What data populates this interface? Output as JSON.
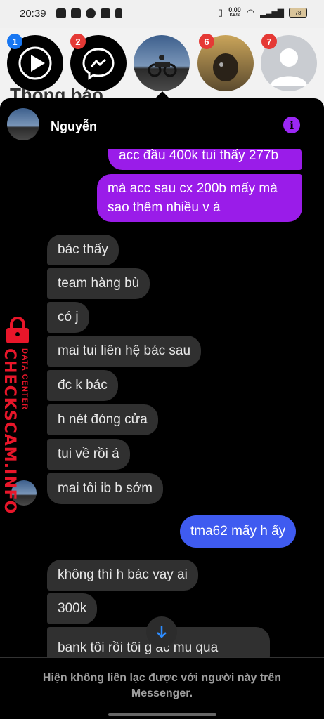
{
  "status_bar": {
    "time": "20:39",
    "net_speed": "0.00",
    "net_unit": "KB/S",
    "battery": "78"
  },
  "chat_heads": [
    {
      "badge": "1",
      "badge_color": "#1877f2"
    },
    {
      "badge": "2",
      "badge_color": "#e53935"
    },
    {
      "badge": "6",
      "badge_color": "#e53935"
    },
    {
      "badge": "7",
      "badge_color": "#e53935"
    }
  ],
  "background_title": "Thông báo",
  "chat": {
    "contact_name": "Nguyễn",
    "messages": [
      {
        "from": "me",
        "text": "acc đầu 400k tui thấy 277b"
      },
      {
        "from": "me",
        "text": "mà acc sau cx 200b mấy mà"
      },
      {
        "from": "me",
        "text": "sao thêm nhiều v á"
      },
      {
        "from": "them",
        "text": "bác thấy"
      },
      {
        "from": "them",
        "text": "team hàng bù"
      },
      {
        "from": "them",
        "text": "có j"
      },
      {
        "from": "them",
        "text": "mai tui liên hệ bác sau"
      },
      {
        "from": "them",
        "text": "đc k bác"
      },
      {
        "from": "them",
        "text": "h nét đóng cửa"
      },
      {
        "from": "them",
        "text": "tui về rồi á"
      },
      {
        "from": "them",
        "text": "mai tôi ib b sớm"
      },
      {
        "from": "me",
        "text": "tma62 mấy h ấy"
      },
      {
        "from": "them",
        "text": "không thì h bác vay ai"
      },
      {
        "from": "them",
        "text": "300k"
      },
      {
        "from": "them",
        "text": "bank tôi rồi tôi g  ác mu qua"
      }
    ],
    "footer_notice_line1": "Hiện không liên lạc được với người này trên",
    "footer_notice_line2": "Messenger."
  },
  "watermark": {
    "line1": "DATA CENTER",
    "line2": "CHECKSCAM.INFO"
  },
  "colors": {
    "outgoing_bubble": "#9a1ce9",
    "outgoing_bubble_recent": "#3f5bf0",
    "incoming_bubble": "#303030",
    "info_icon": "#9b27f5",
    "watermark": "#e8162a"
  }
}
